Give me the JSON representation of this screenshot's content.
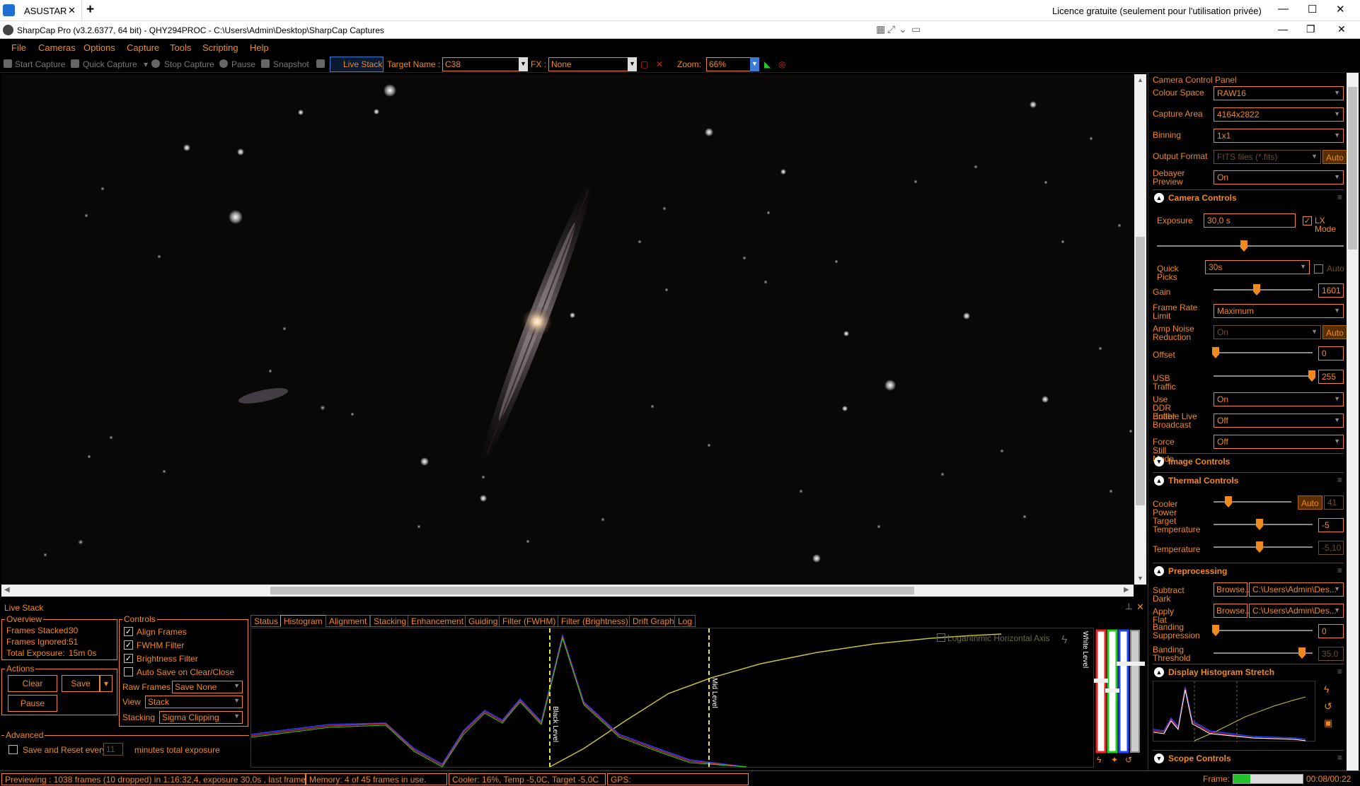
{
  "remote": {
    "tab": "ASUSTAR",
    "license": "Licence gratuite (seulement pour l'utilisation privée)"
  },
  "window": {
    "title": "SharpCap Pro (v3.2.6377, 64 bit) - QHY294PROC - C:\\Users\\Admin\\Desktop\\SharpCap Captures"
  },
  "menu": [
    "File",
    "Cameras",
    "Options",
    "Capture",
    "Tools",
    "Scripting",
    "Help"
  ],
  "toolbar": {
    "start_capture": "Start Capture",
    "quick_capture": "Quick Capture",
    "stop_capture": "Stop Capture",
    "pause": "Pause",
    "snapshot": "Snapshot",
    "live_stack": "Live Stack",
    "target_label": "Target Name :",
    "target_value": "C38",
    "fx_label": "FX :",
    "fx_value": "None",
    "zoom_label": "Zoom:",
    "zoom_value": "66%"
  },
  "livestack": {
    "title": "Live Stack",
    "overview": {
      "title": "Overview",
      "frames_stacked_label": "Frames Stacked:",
      "frames_stacked": "30",
      "frames_ignored_label": "Frames Ignored:",
      "frames_ignored": "51",
      "total_exposure_label": "Total Exposure:",
      "total_exposure": "15m 0s"
    },
    "actions": {
      "title": "Actions",
      "clear": "Clear",
      "save": "Save",
      "pause": "Pause"
    },
    "advanced": {
      "title": "Advanced",
      "save_reset": "Save and Reset every",
      "minutes": "11",
      "minutes_suffix": "minutes total exposure"
    },
    "controls": {
      "title": "Controls",
      "align_frames": "Align Frames",
      "fwhm_filter": "FWHM Filter",
      "brightness_filter": "Brightness Filter",
      "auto_save": "Auto Save on Clear/Close",
      "raw_frames_label": "Raw Frames",
      "raw_frames": "Save None",
      "view_label": "View",
      "view": "Stack",
      "stacking_label": "Stacking",
      "stacking": "Sigma Clipping"
    },
    "tabs": [
      "Status",
      "Histogram",
      "Alignment",
      "Stacking",
      "Enhancement",
      "Guiding",
      "Filter (FWHM)",
      "Filter (Brightness)",
      "Drift Graph",
      "Log"
    ],
    "active_tab": "Histogram",
    "histogram": {
      "log_axis": "Logarithmic Horizontal Axis",
      "black_level": "Black Level",
      "mid_level": "Mid Level",
      "white_level": "White Level"
    }
  },
  "status": {
    "preview": "Previewing : 1038 frames (10 dropped) in 1:16:32,4, exposure 30,0s , last frame 30,0s",
    "memory": "Memory: 4 of 45 frames in use.",
    "cooler": "Cooler: 16%, Temp -5,0C, Target -5,0C",
    "gps": "GPS:",
    "frame_label": "Frame:",
    "frame_progress": 0.24,
    "time": "00:08/00:22"
  },
  "panel": {
    "title": "Camera Control Panel",
    "colour_space_label": "Colour Space",
    "colour_space": "RAW16",
    "capture_area_label": "Capture Area",
    "capture_area": "4164x2822",
    "binning_label": "Binning",
    "binning": "1x1",
    "output_format_label": "Output Format",
    "output_format": "FITS files (*.fits)",
    "auto": "Auto",
    "debayer_label": "Debayer Preview",
    "debayer": "On",
    "camera_controls": "Camera Controls",
    "exposure_label": "Exposure",
    "exposure": "30,0 s",
    "lx_mode": "LX Mode",
    "quick_picks_label": "Quick Picks",
    "quick_picks": "30s",
    "quick_auto": "Auto",
    "gain_label": "Gain",
    "gain": "1601",
    "frame_rate_label": "Frame Rate Limit",
    "frame_rate": "Maximum",
    "amp_noise_label": "Amp Noise Reduction",
    "amp_noise": "On",
    "offset_label": "Offset",
    "offset": "0",
    "usb_label": "USB Traffic",
    "usb": "255",
    "ddr_label": "Use DDR Buffer",
    "ddr": "On",
    "live_broadcast_label": "Enable Live Broadcast",
    "live_broadcast": "Off",
    "force_still_label": "Force Still Mode",
    "force_still": "Off",
    "image_controls": "Image Controls",
    "thermal_controls": "Thermal Controls",
    "cooler_power_label": "Cooler Power",
    "cooler_power": "41",
    "target_temp_label": "Target Temperature",
    "target_temp": "-5",
    "temperature_label": "Temperature",
    "temperature": "-5,10",
    "preprocessing": "Preprocessing",
    "subtract_dark_label": "Subtract Dark",
    "browse": "Browse...",
    "subtract_dark": "C:\\Users\\Admin\\Des...",
    "apply_flat_label": "Apply Flat",
    "apply_flat": "C:\\Users\\Admin\\Des...",
    "banding_supp_label": "Banding Suppression",
    "banding_supp": "0",
    "banding_thresh_label": "Banding Threshold",
    "banding_thresh": "35,0",
    "display_hist": "Display Histogram Stretch",
    "scope_controls": "Scope Controls"
  }
}
